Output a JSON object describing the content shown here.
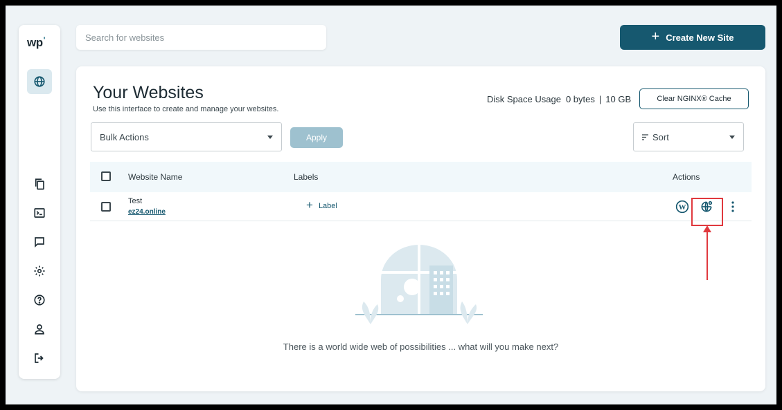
{
  "app": {
    "logo": "wp"
  },
  "search": {
    "placeholder": "Search for websites"
  },
  "header": {
    "create_label": "Create New Site",
    "create_icon": "plus-icon"
  },
  "sidebar": {
    "items": [
      {
        "name": "websites",
        "icon": "globe-icon",
        "active": true
      },
      {
        "name": "files",
        "icon": "copy-icon"
      },
      {
        "name": "terminal",
        "icon": "terminal-icon"
      },
      {
        "name": "messages",
        "icon": "chat-icon"
      },
      {
        "name": "settings",
        "icon": "gear-icon"
      },
      {
        "name": "help",
        "icon": "help-icon"
      },
      {
        "name": "account",
        "icon": "user-icon"
      },
      {
        "name": "logout",
        "icon": "logout-icon"
      }
    ]
  },
  "main": {
    "title": "Your Websites",
    "subtitle": "Use this interface to create and manage your websites.",
    "disk_label": "Disk Space Usage",
    "disk_used": "0 bytes",
    "disk_separator": "|",
    "disk_total": "10 GB",
    "clear_cache_label": "Clear NGINX® Cache",
    "bulk_actions_label": "Bulk Actions",
    "apply_label": "Apply",
    "sort_label": "Sort"
  },
  "table": {
    "headers": {
      "name": "Website Name",
      "labels": "Labels",
      "actions": "Actions"
    },
    "rows": [
      {
        "name": "Test",
        "domain": "ez24.online",
        "add_label": "Label",
        "actions": [
          "wordpress-icon",
          "globe-settings-icon",
          "more-vertical-icon"
        ]
      }
    ]
  },
  "empty_state": {
    "text": "There is a world wide web of possibilities ... what will you make next?"
  },
  "colors": {
    "primary": "#16586f",
    "apply_disabled": "#9ec1cf",
    "highlight": "#e0393e",
    "background": "#eef3f6"
  }
}
